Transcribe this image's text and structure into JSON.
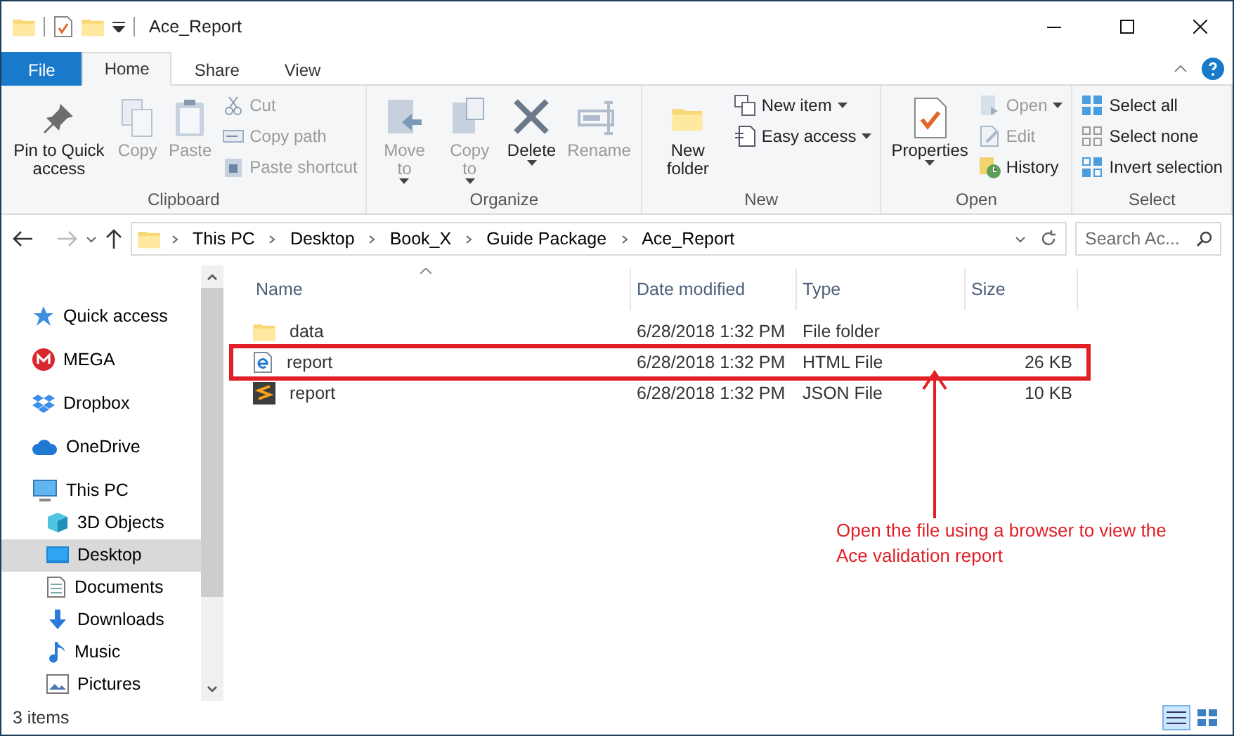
{
  "window": {
    "title": "Ace_Report"
  },
  "tabs": [
    {
      "label": "File",
      "kind": "file",
      "selected": false
    },
    {
      "label": "Home",
      "kind": "tab",
      "selected": true
    },
    {
      "label": "Share",
      "kind": "tab",
      "selected": false
    },
    {
      "label": "View",
      "kind": "tab",
      "selected": false
    }
  ],
  "ribbon": [
    {
      "group": "Clipboard",
      "commands": [
        {
          "kind": "large",
          "label": "Pin to Quick access",
          "dropdown": false,
          "disabled": false
        },
        {
          "kind": "large",
          "label": "Copy",
          "dropdown": false,
          "disabled": true
        },
        {
          "kind": "large",
          "label": "Paste",
          "dropdown": false,
          "disabled": true
        },
        {
          "kind": "stack",
          "items": [
            {
              "label": "Cut",
              "dropdown": false,
              "disabled": true
            },
            {
              "label": "Copy path",
              "dropdown": false,
              "disabled": true
            },
            {
              "label": "Paste shortcut",
              "dropdown": false,
              "disabled": true
            }
          ]
        }
      ]
    },
    {
      "group": "Organize",
      "commands": [
        {
          "kind": "large",
          "label": "Move to",
          "dropdown": true,
          "disabled": true
        },
        {
          "kind": "large",
          "label": "Copy to",
          "dropdown": true,
          "disabled": true
        },
        {
          "kind": "large",
          "label": "Delete",
          "dropdown": true,
          "disabled": false
        },
        {
          "kind": "large",
          "label": "Rename",
          "dropdown": false,
          "disabled": true
        }
      ]
    },
    {
      "group": "New",
      "commands": [
        {
          "kind": "large",
          "label": "New folder",
          "dropdown": false,
          "disabled": false
        },
        {
          "kind": "stack",
          "items": [
            {
              "label": "New item",
              "dropdown": true,
              "disabled": false
            },
            {
              "label": "Easy access",
              "dropdown": true,
              "disabled": false
            }
          ]
        }
      ]
    },
    {
      "group": "Open",
      "commands": [
        {
          "kind": "large",
          "label": "Properties",
          "dropdown": true,
          "disabled": false
        },
        {
          "kind": "stack",
          "items": [
            {
              "label": "Open",
              "dropdown": true,
              "disabled": true
            },
            {
              "label": "Edit",
              "dropdown": false,
              "disabled": true
            },
            {
              "label": "History",
              "dropdown": false,
              "disabled": false
            }
          ]
        }
      ]
    },
    {
      "group": "Select",
      "commands": [
        {
          "kind": "stack",
          "items": [
            {
              "label": "Select all",
              "dropdown": false,
              "disabled": false
            },
            {
              "label": "Select none",
              "dropdown": false,
              "disabled": false
            },
            {
              "label": "Invert selection",
              "dropdown": false,
              "disabled": false
            }
          ]
        }
      ]
    }
  ],
  "address": {
    "path": [
      "This PC",
      "Desktop",
      "Book_X",
      "Guide Package",
      "Ace_Report"
    ],
    "search_placeholder": "Search Ac..."
  },
  "sidebar": {
    "items": [
      {
        "label": "Quick access",
        "selected": false
      },
      {
        "label": "MEGA",
        "selected": false
      },
      {
        "label": "Dropbox",
        "selected": false
      },
      {
        "label": "OneDrive",
        "selected": false
      },
      {
        "label": "This PC",
        "selected": false,
        "children": [
          {
            "label": "3D Objects",
            "selected": false
          },
          {
            "label": "Desktop",
            "selected": true
          },
          {
            "label": "Documents",
            "selected": false
          },
          {
            "label": "Downloads",
            "selected": false
          },
          {
            "label": "Music",
            "selected": false
          },
          {
            "label": "Pictures",
            "selected": false
          }
        ]
      }
    ]
  },
  "table": {
    "columns": [
      "Name",
      "Date modified",
      "Type",
      "Size"
    ],
    "rows": [
      {
        "kind": "folder",
        "name": "data",
        "date": "6/28/2018 1:32 PM",
        "type": "File folder",
        "highlighted": false
      },
      {
        "kind": "html",
        "name": "report",
        "date": "6/28/2018 1:32 PM",
        "type": "HTML File",
        "size": "26 KB",
        "highlighted": true
      },
      {
        "kind": "json",
        "name": "report",
        "date": "6/28/2018 1:32 PM",
        "type": "JSON File",
        "size": "10 KB",
        "highlighted": false
      }
    ]
  },
  "annotation": {
    "text": "Open the file using a browser to view the Ace validation report"
  },
  "status_bar": {
    "count": "3 items"
  }
}
